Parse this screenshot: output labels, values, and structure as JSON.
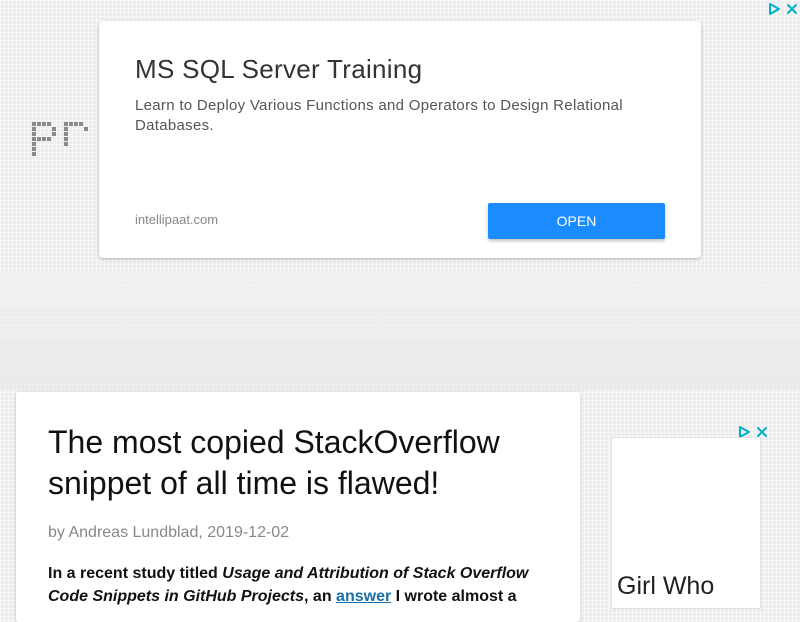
{
  "top_ad": {
    "title": "MS SQL Server Training",
    "description": "Learn to Deploy Various Functions and Operators to Design Relational Databases.",
    "domain": "intellipaat.com",
    "open_label": "OPEN"
  },
  "logo": {
    "text": "pr"
  },
  "article": {
    "title": "The most copied StackOverflow snippet of all time is flawed!",
    "byline_prefix": "by ",
    "author": "Andreas Lundblad",
    "date": "2019-12-02",
    "intro_lead": "In a recent study titled ",
    "study_title": "Usage and Attribution of Stack Overflow Code Snippets in GitHub Projects",
    "intro_mid": ", an ",
    "answer_link": "answer",
    "intro_tail": " I wrote almost a"
  },
  "side_ad": {
    "headline": "Girl Who"
  },
  "icons": {
    "adchoices": "adchoices-icon",
    "close": "close-icon"
  },
  "colors": {
    "open_button": "#1a8cff",
    "link": "#1a6fa8",
    "adchoices": "#00aecd"
  }
}
